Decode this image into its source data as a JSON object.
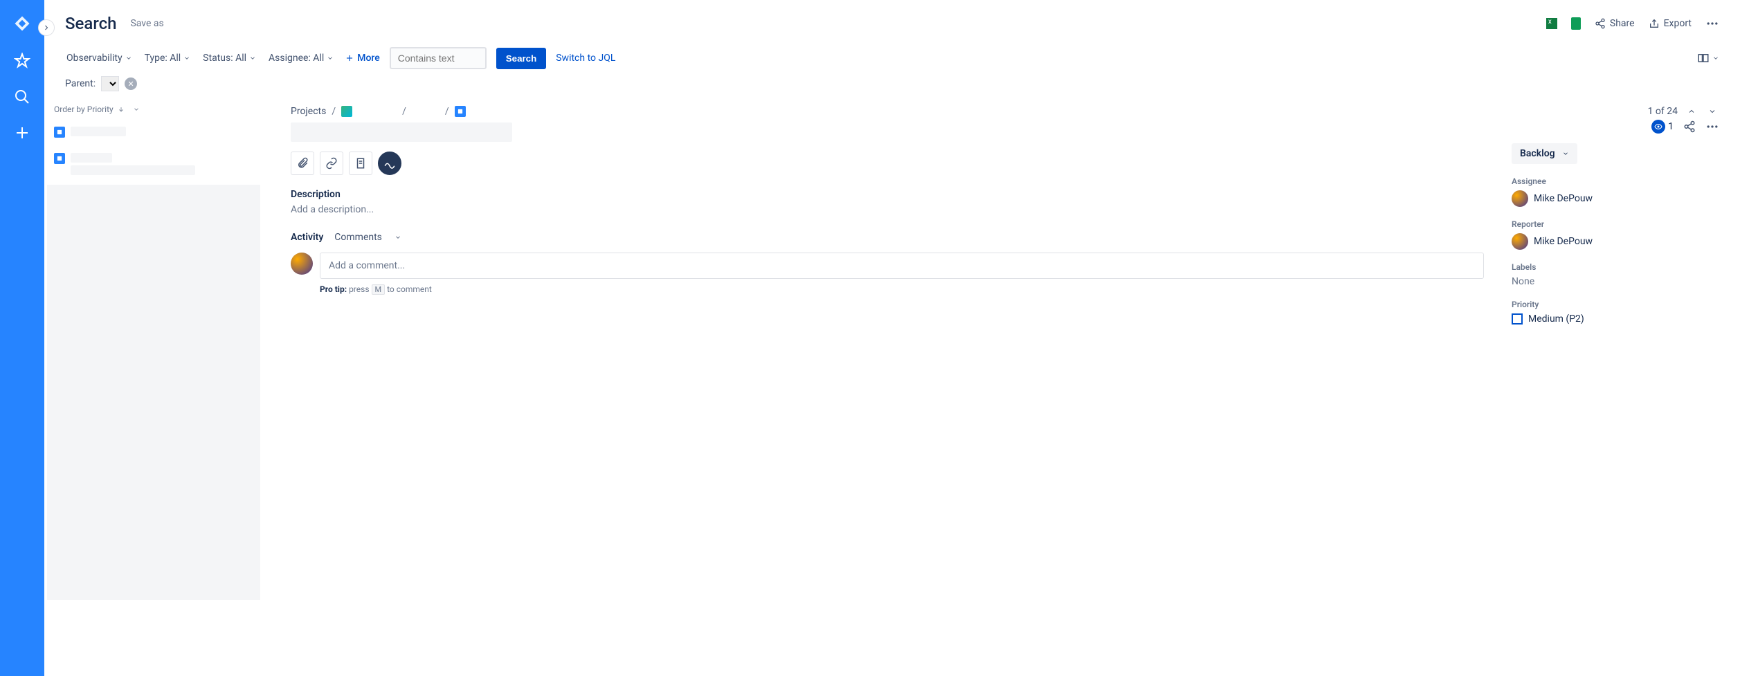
{
  "header": {
    "title": "Search",
    "save_as": "Save as",
    "share": "Share",
    "export": "Export"
  },
  "filters": {
    "project": "Observability",
    "type_label": "Type: All",
    "status_label": "Status: All",
    "assignee_label": "Assignee: All",
    "more": "More",
    "search_placeholder": "Contains text",
    "search_btn": "Search",
    "switch_jql": "Switch to JQL",
    "parent_label": "Parent:"
  },
  "list": {
    "order_label": "Order by Priority"
  },
  "pager": {
    "text": "1 of 24"
  },
  "breadcrumbs": {
    "root": "Projects"
  },
  "watch": {
    "count": "1"
  },
  "status": {
    "label": "Backlog"
  },
  "detail": {
    "description_heading": "Description",
    "description_placeholder": "Add a description...",
    "activity_heading": "Activity",
    "activity_tab": "Comments",
    "comment_placeholder": "Add a comment...",
    "pro_tip_label": "Pro tip:",
    "pro_tip_press": "press",
    "pro_tip_key": "M",
    "pro_tip_rest": "to comment"
  },
  "fields": {
    "assignee_label": "Assignee",
    "assignee_value": "Mike DePouw",
    "reporter_label": "Reporter",
    "reporter_value": "Mike DePouw",
    "labels_label": "Labels",
    "labels_value": "None",
    "priority_label": "Priority",
    "priority_value": "Medium (P2)"
  }
}
